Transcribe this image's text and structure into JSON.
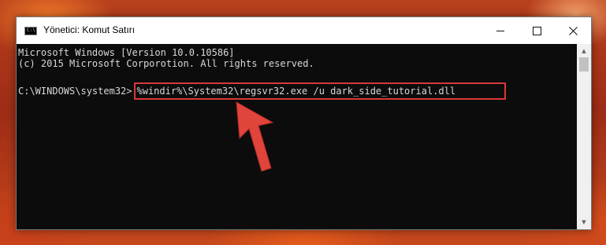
{
  "window": {
    "title": "Yönetici: Komut Satırı",
    "icon": "cmd-icon"
  },
  "controls": {
    "minimize": "minimize-icon",
    "maximize": "maximize-icon",
    "close": "close-icon"
  },
  "console": {
    "line1": "Microsoft Windows [Version 10.0.10586]",
    "line2": "(c) 2015 Microsoft Corporotion. All rights reserved.",
    "prompt": "C:\\WINDOWS\\system32>",
    "command": "%windir%\\System32\\regsvr32.exe /u dark_side_tutorial.dll"
  },
  "colors": {
    "highlight": "#d9383a",
    "arrow": "#e0443a",
    "console_bg": "#0c0c0c",
    "console_text": "#d8d8d8"
  }
}
